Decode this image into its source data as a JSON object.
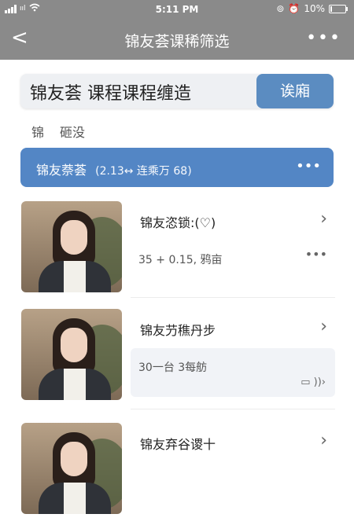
{
  "status": {
    "time": "5:11 PM",
    "battery": "10%",
    "battery_level": 0.1
  },
  "nav": {
    "back": "<",
    "title": "锦友荟课稀筛选",
    "more": "•••"
  },
  "search": {
    "text": "锦友荟 课程课程缠造",
    "button": "诶廂"
  },
  "tabs": [
    "锦",
    "砸没"
  ],
  "filter": {
    "title": "锦友萘荟",
    "info": "(2.13↔ 连乘万 68)",
    "more": "•••"
  },
  "courses": [
    {
      "title": "锦友恣锁:(♡)",
      "meta": "35 + 0.15, 鸦亩"
    },
    {
      "title": "锦友芀穛丹步",
      "meta": "30一台 3每舫"
    },
    {
      "title": "锦友弃谷谡十",
      "meta": ""
    }
  ]
}
